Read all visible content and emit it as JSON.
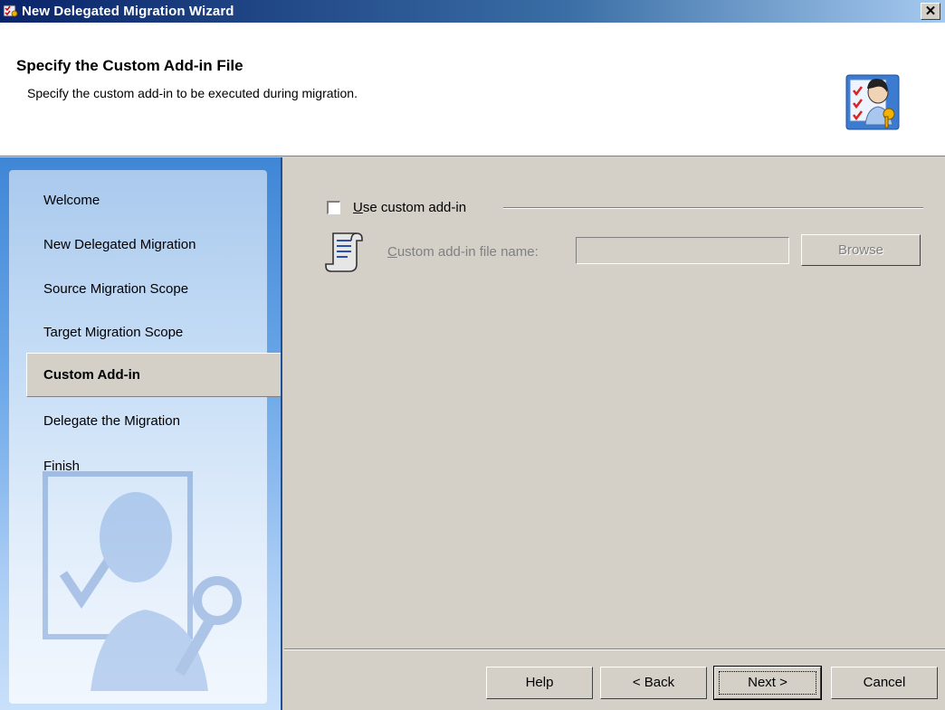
{
  "window": {
    "title": "New Delegated Migration Wizard",
    "close_glyph": "✕"
  },
  "header": {
    "title": "Specify the Custom Add-in File",
    "subtitle": "Specify the custom add-in to be executed during migration.",
    "icon": "user-checklist-key-icon"
  },
  "sidebar": {
    "items": [
      {
        "label": "Welcome",
        "selected": false
      },
      {
        "label": "New Delegated Migration",
        "selected": false
      },
      {
        "label": "Source Migration Scope",
        "selected": false
      },
      {
        "label": "Target Migration Scope",
        "selected": false
      },
      {
        "label": "Custom Add-in",
        "selected": true
      },
      {
        "label": "Delegate the Migration",
        "selected": false
      },
      {
        "label": "Finish",
        "selected": false
      }
    ]
  },
  "main": {
    "use_custom_addin": {
      "label": "Use custom add-in",
      "checked": false
    },
    "file_name": {
      "label": "Custom add-in file name:",
      "value": "",
      "enabled": false
    },
    "browse_label": "Browse",
    "script_icon": "script-scroll-icon"
  },
  "footer": {
    "help": "Help",
    "back": "< Back",
    "next": "Next >",
    "cancel": "Cancel"
  }
}
